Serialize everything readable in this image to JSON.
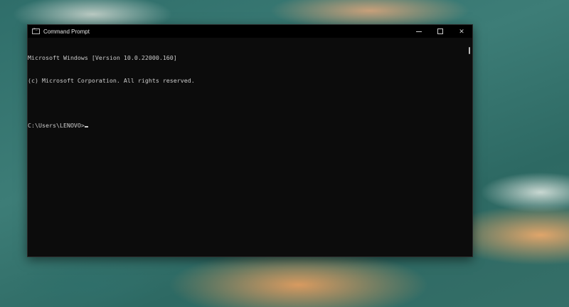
{
  "window": {
    "title": "Command Prompt",
    "controls": {
      "minimize": "minimize",
      "maximize": "maximize",
      "close": "✕"
    }
  },
  "console": {
    "lines": [
      "Microsoft Windows [Version 10.0.22000.160]",
      "(c) Microsoft Corporation. All rights reserved.",
      ""
    ],
    "prompt": "C:\\Users\\LENOVO>"
  }
}
